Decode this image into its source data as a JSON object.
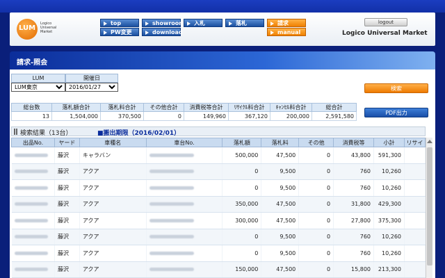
{
  "header": {
    "logo": {
      "mark": "LUM",
      "lines": [
        "Logico",
        "Universal",
        "Market"
      ]
    },
    "logout_label": "logout",
    "brand": "Logico Universal Market",
    "nav": [
      {
        "label": "top",
        "active": false
      },
      {
        "label": "showroom",
        "active": false
      },
      {
        "label": "入札",
        "active": false
      },
      {
        "label": "落札",
        "active": false
      },
      {
        "label": "請求",
        "active": true
      },
      {
        "label": "PW変更",
        "active": false
      },
      {
        "label": "download",
        "active": false
      },
      {
        "label": "manual",
        "active": true
      }
    ]
  },
  "page": {
    "title": "請求-照会"
  },
  "filter": {
    "lum_header": "LUM",
    "date_header": "開催日",
    "lum_value": "LUM東京",
    "date_value": "2016/01/27"
  },
  "buttons": {
    "search": "検索",
    "pdf": "PDF出力"
  },
  "totals": {
    "headers": [
      "総台数",
      "落札額合計",
      "落札料合計",
      "その他合計",
      "消費税等合計",
      "ﾘｻｲｸﾙ料合計",
      "ｷｬﾝｾﾙ料合計",
      "総合計"
    ],
    "values": [
      "13",
      "1,504,000",
      "370,500",
      "0",
      "149,960",
      "367,120",
      "200,000",
      "2,591,580"
    ]
  },
  "results": {
    "label": "検索結果（13台）",
    "deadline": "■搬出期限（2016/02/01）",
    "columns": [
      "出品No.",
      "ヤード",
      "車種名",
      "車台No.",
      "落札額",
      "落札料",
      "その他",
      "消費税等",
      "小計",
      "リサイ"
    ],
    "rows": [
      {
        "yard": "藤沢",
        "model": "キャラバン",
        "bid": "500,000",
        "fee": "47,500",
        "other": "0",
        "tax": "43,800",
        "subtotal": "591,300"
      },
      {
        "yard": "藤沢",
        "model": "アクア",
        "bid": "0",
        "fee": "9,500",
        "other": "0",
        "tax": "760",
        "subtotal": "10,260"
      },
      {
        "yard": "藤沢",
        "model": "アクア",
        "bid": "0",
        "fee": "9,500",
        "other": "0",
        "tax": "760",
        "subtotal": "10,260"
      },
      {
        "yard": "藤沢",
        "model": "アクア",
        "bid": "350,000",
        "fee": "47,500",
        "other": "0",
        "tax": "31,800",
        "subtotal": "429,300"
      },
      {
        "yard": "藤沢",
        "model": "アクア",
        "bid": "300,000",
        "fee": "47,500",
        "other": "0",
        "tax": "27,800",
        "subtotal": "375,300"
      },
      {
        "yard": "藤沢",
        "model": "アクア",
        "bid": "0",
        "fee": "9,500",
        "other": "0",
        "tax": "760",
        "subtotal": "10,260"
      },
      {
        "yard": "藤沢",
        "model": "アクア",
        "bid": "0",
        "fee": "9,500",
        "other": "0",
        "tax": "760",
        "subtotal": "10,260"
      },
      {
        "yard": "藤沢",
        "model": "アクア",
        "bid": "150,000",
        "fee": "47,500",
        "other": "0",
        "tax": "15,800",
        "subtotal": "213,300"
      }
    ]
  }
}
